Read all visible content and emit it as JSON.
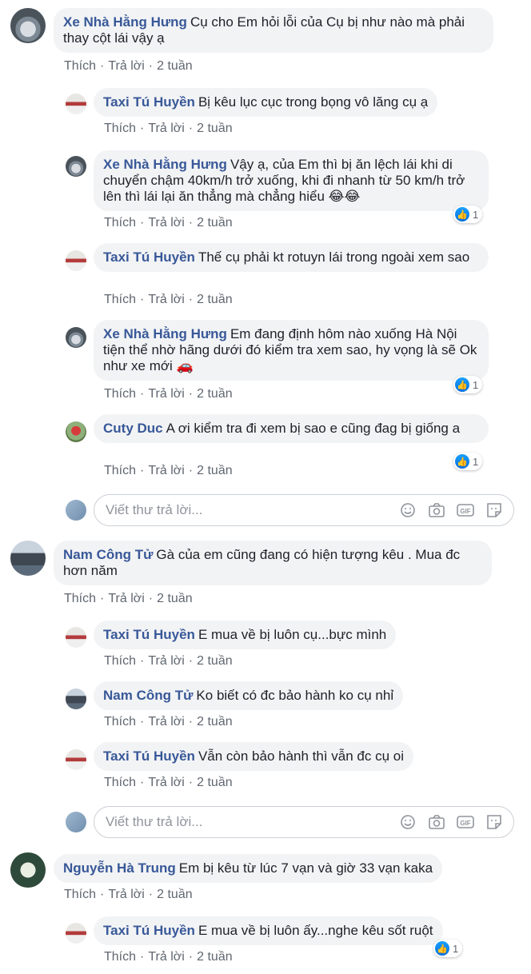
{
  "actions": {
    "like": "Thích",
    "reply": "Trả lời",
    "sep": "·"
  },
  "reply_placeholder": "Viết thư trả lời...",
  "threads": [
    {
      "root": {
        "name": "Xe Nhà Hằng Hưng",
        "text": "Cụ cho Em hỏi lỗi của Cụ bị như nào mà phải thay cột lái vậy ạ",
        "time": "2 tuần"
      },
      "replies": [
        {
          "name": "Taxi Tú Huyền",
          "text": "Bị kêu lục cục trong bọng vô lăng cụ ạ",
          "time": "2 tuần"
        },
        {
          "name": "Xe Nhà Hằng Hưng",
          "text": "Vậy ạ, của Em thì bị ăn lệch lái khi di chuyển chậm 40km/h trở xuống, khi đi nhanh từ 50 km/h trở lên thì lái lại ăn thẳng mà chẳng hiểu 😂😂",
          "time": "2 tuần",
          "likes": "1"
        },
        {
          "name": "Taxi Tú Huyền",
          "text": "Thế cụ phải kt rotuyn lái trong ngoài xem sao",
          "time": "2 tuần"
        },
        {
          "name": "Xe Nhà Hằng Hưng",
          "text": "Em đang định hôm nào xuống Hà Nội tiện thể nhờ hãng dưới đó kiểm tra xem sao, hy vọng là sẽ Ok như xe mới 🚗",
          "time": "2 tuần",
          "likes": "1"
        },
        {
          "name": "Cuty Duc",
          "text": "A ơi kiểm tra đi xem bị sao e cũng đag bị giống a",
          "time": "2 tuần",
          "likes": "1"
        }
      ]
    },
    {
      "root": {
        "name": "Nam Công Tử",
        "text": "Gà của em cũng đang có hiện tượng kêu . Mua đc hơn năm",
        "time": "2 tuần"
      },
      "replies": [
        {
          "name": "Taxi Tú Huyền",
          "text": "E mua về bị luôn cụ...bực mình",
          "time": "2 tuần"
        },
        {
          "name": "Nam Công Tử",
          "text": "Ko biết có đc bảo hành ko cụ nhỉ",
          "time": "2 tuần"
        },
        {
          "name": "Taxi Tú Huyền",
          "text": "Vẫn còn bảo hành thì vẫn đc cụ oi",
          "time": "2 tuần"
        }
      ]
    },
    {
      "root": {
        "name": "Nguyễn Hà Trung",
        "text": "Em bị kêu từ lúc 7 vạn và giờ 33 vạn kaka",
        "time": "2 tuần"
      },
      "replies": [
        {
          "name": "Taxi Tú Huyền",
          "text": "E mua về bị luôn ấy...nghe kêu sốt ruột",
          "time": "2 tuần",
          "likes": "1"
        }
      ]
    }
  ]
}
